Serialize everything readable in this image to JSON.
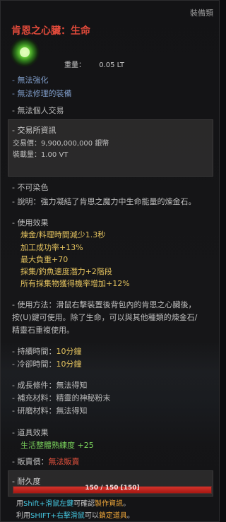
{
  "category": "裝備類",
  "title": "肯恩之心臟：生命",
  "icon": "green-gem-icon",
  "weight": {
    "label": "重量：",
    "value": "0.05 LT"
  },
  "flags": [
    "- 無法強化",
    "- 無法修理的裝備",
    "- 無法個人交易"
  ],
  "market": {
    "header": "- 交易所資訊",
    "price": "交易價：9,900,000,000 銀幣",
    "load": "裝載量：1.00 VT"
  },
  "no_dye": "- 不可染色",
  "description": "- 說明：強力凝結了肯恩之魔力中生命能量的煉金石。",
  "effects": {
    "header": "- 使用效果",
    "lines": [
      "煉金/料理時間減少1.3秒",
      "加工成功率+13%",
      "最大負重+70",
      "採集/釣魚速度潛力+2階段",
      "所有採集物獲得機率增加+12%"
    ]
  },
  "usage": [
    "- 使用方法：滑鼠右擊裝置後背包內的肯恩之心臟後，",
    "按(U)鍵可使用。除了生命，可以與其他種類的煉金石/",
    "精靈石重複使用。"
  ],
  "duration": {
    "label": "- 持續時間：",
    "value": "10分鐘"
  },
  "cooldown": {
    "label": "- 冷卻時間：",
    "value": "10分鐘"
  },
  "growth": "- 成長條件：無法得知",
  "supplement": "- 補充材料：精靈的神秘粉末",
  "research": "- 研磨材料：無法得知",
  "item_effect": {
    "header": "- 道具效果",
    "line": "生活整體熟練度 +25"
  },
  "sell": {
    "label": "- 販賣價：",
    "value": "無法販賣"
  },
  "durability": {
    "label": "- 耐久度",
    "text": "150 / 150 [150]",
    "fraction": 1.0
  },
  "footer": {
    "l1a": "用",
    "l1b": "Shift+滑鼠左鍵",
    "l1c": "可確認",
    "l1d": "製作資訊",
    "l1e": "。",
    "l2a": "利用",
    "l2b": "SHIFT+右擊滑鼠",
    "l2c": "可以",
    "l2d": "鎖定道具",
    "l2e": "。"
  }
}
